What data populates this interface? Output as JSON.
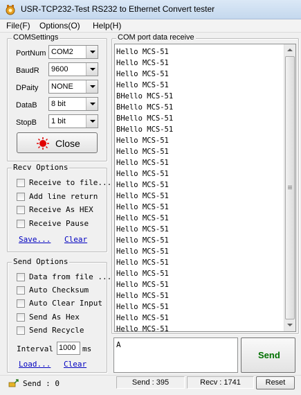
{
  "window": {
    "title": "USR-TCP232-Test  RS232 to Ethernet Convert tester"
  },
  "menu": {
    "file": "File(F)",
    "options": "Options(O)",
    "help": "Help(H)"
  },
  "com_settings": {
    "title": "COMSettings",
    "port_label": "PortNum",
    "port_value": "COM2",
    "baud_label": "BaudR",
    "baud_value": "9600",
    "parity_label": "DPaity",
    "parity_value": "NONE",
    "data_label": "DataB",
    "data_value": "8 bit",
    "stop_label": "StopB",
    "stop_value": "1 bit",
    "close_label": "Close"
  },
  "recv_options": {
    "title": "Recv Options",
    "items": [
      "Receive to file...",
      "Add line return",
      "Receive As HEX",
      "Receive Pause"
    ],
    "save_label": "Save...",
    "clear_label": "Clear"
  },
  "send_options": {
    "title": "Send Options",
    "items": [
      "Data from file ...",
      "Auto Checksum",
      "Auto Clear Input",
      "Send As Hex",
      "Send Recycle"
    ],
    "interval_label": "Interval",
    "interval_value": "1000",
    "interval_unit": "ms",
    "load_label": "Load...",
    "clear_label": "Clear"
  },
  "receive_panel": {
    "title": "COM port data receive",
    "lines": [
      "Hello MCS-51",
      "Hello MCS-51",
      "Hello MCS-51",
      "Hello MCS-51",
      "BHello MCS-51",
      "BHello MCS-51",
      "BHello MCS-51",
      "BHello MCS-51",
      "Hello MCS-51",
      "Hello MCS-51",
      "Hello MCS-51",
      "Hello MCS-51",
      "Hello MCS-51",
      "Hello MCS-51",
      "Hello MCS-51",
      "Hello MCS-51",
      "Hello MCS-51",
      "Hello MCS-51",
      "Hello MCS-51",
      "Hello MCS-51",
      "Hello MCS-51",
      "Hello MCS-51",
      "Hello MCS-51",
      "Hello MCS-51",
      "Hello MCS-51",
      "Hello MCS-51"
    ]
  },
  "send_panel": {
    "input_value": "A",
    "send_label": "Send"
  },
  "status": {
    "send_count": "Send : 0",
    "send_total": "Send : 395",
    "recv_total": "Recv : 1741",
    "reset_label": "Reset"
  }
}
